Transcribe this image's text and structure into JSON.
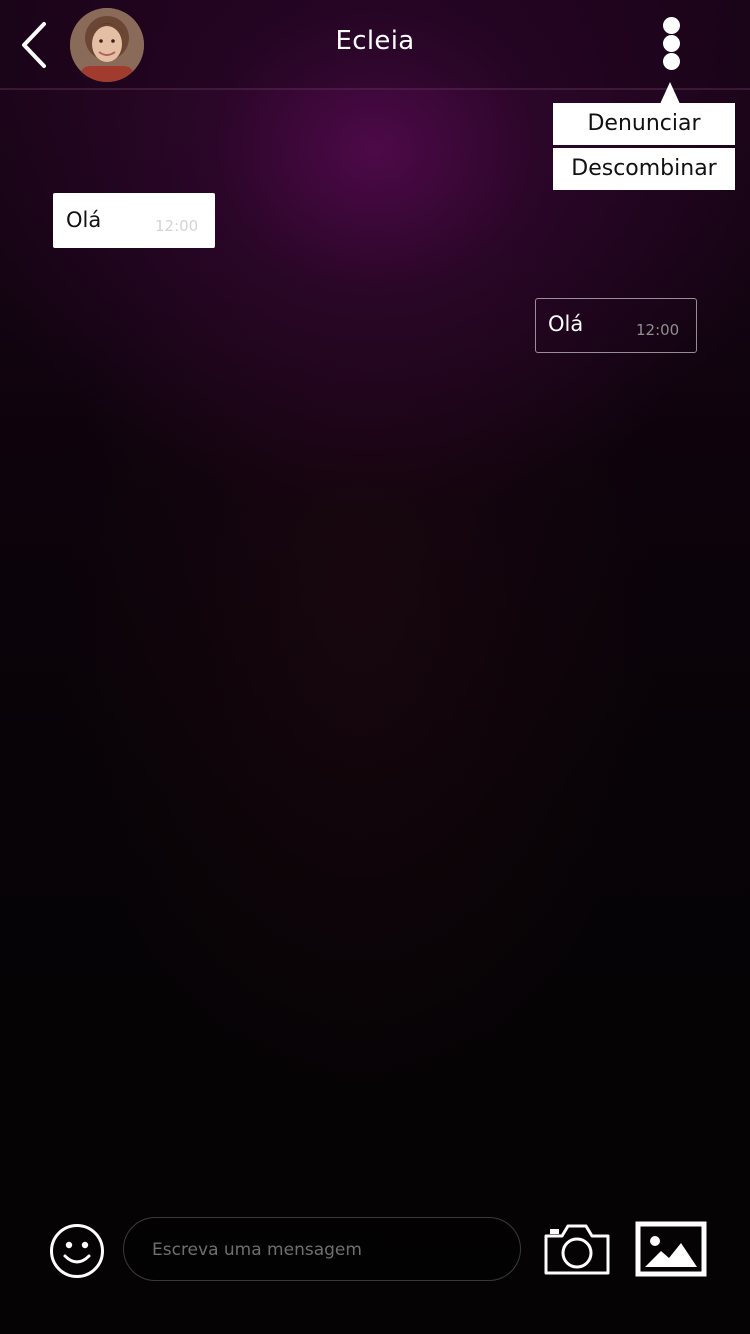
{
  "header": {
    "title": "Ecleia",
    "back_icon": "chevron-left-icon",
    "more_icon": "more-vertical-icon"
  },
  "menu": {
    "items": [
      {
        "label": "Denunciar"
      },
      {
        "label": "Descombinar"
      }
    ]
  },
  "messages": [
    {
      "direction": "incoming",
      "text": "Olá",
      "time": "12:00"
    },
    {
      "direction": "outgoing",
      "text": "Olá",
      "time": "12:00"
    }
  ],
  "composer": {
    "placeholder": "Escreva uma mensagem",
    "value": "",
    "emoji_icon": "smiley-icon",
    "camera_icon": "camera-icon",
    "gallery_icon": "image-icon"
  },
  "colors": {
    "background_top": "#3d0a3a",
    "background_bottom": "#050304",
    "bubble_incoming": "#ffffff",
    "bubble_outgoing_border": "#ffffff"
  }
}
